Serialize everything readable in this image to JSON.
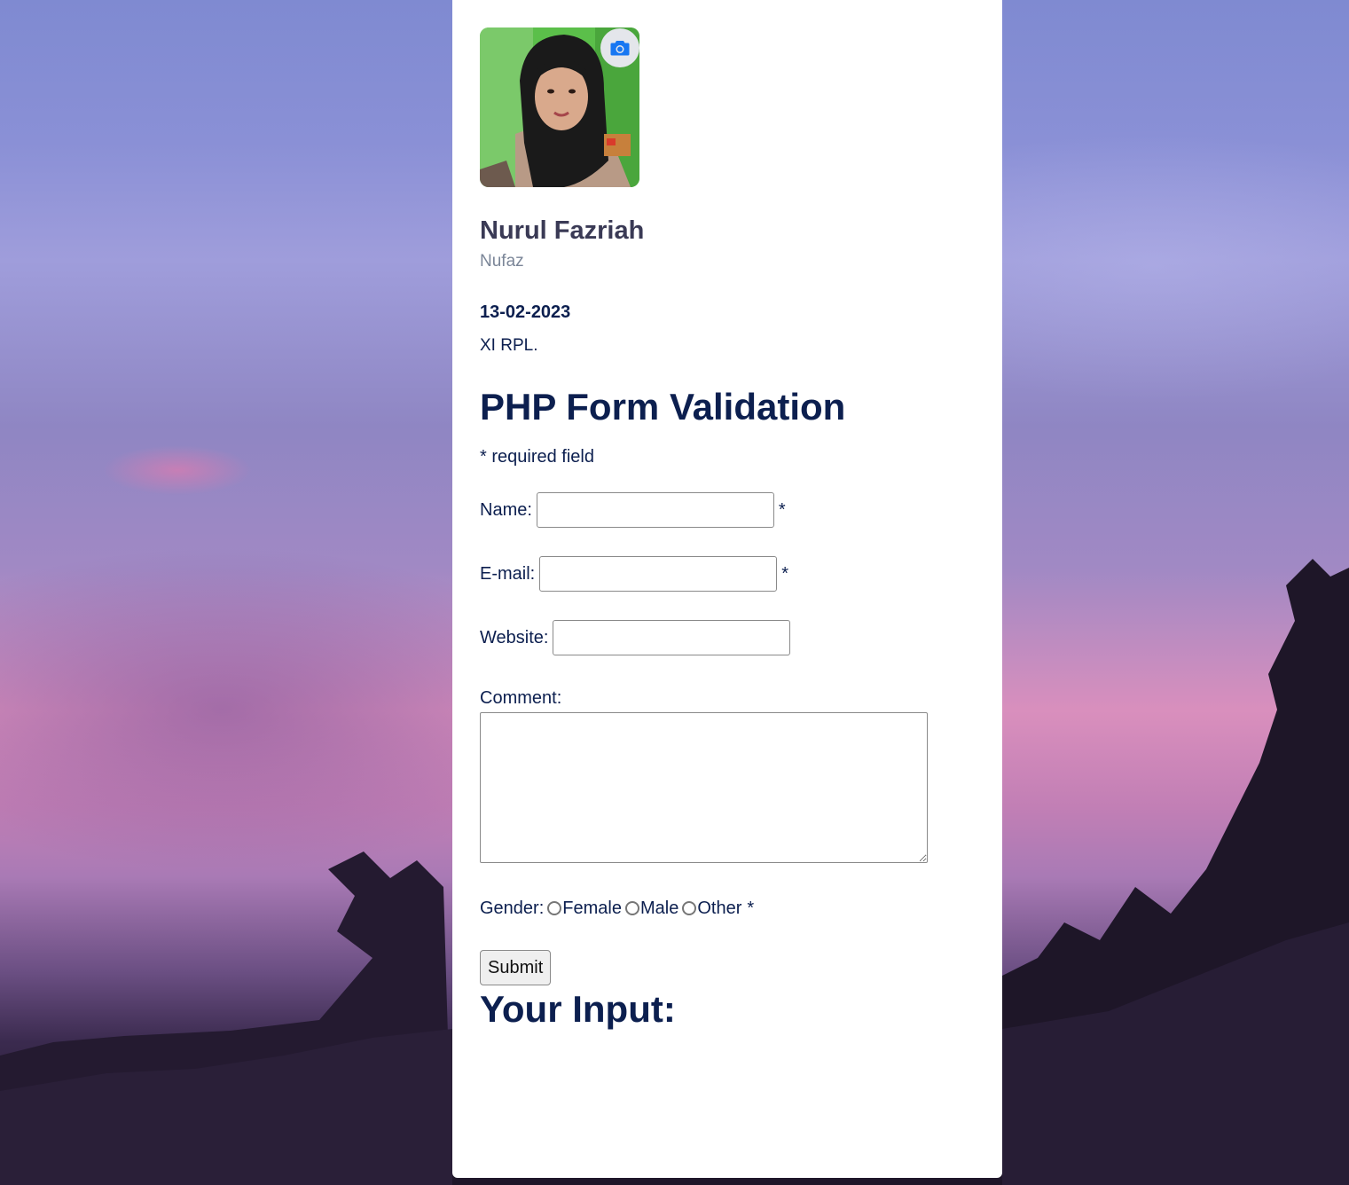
{
  "profile": {
    "name": "Nurul Fazriah",
    "nickname": "Nufaz",
    "date": "13-02-2023",
    "class": "XI RPL."
  },
  "form": {
    "title": "PHP Form Validation",
    "required_note": "* required field",
    "name_label": "Name:",
    "name_value": "",
    "email_label": "E-mail:",
    "email_value": "",
    "website_label": "Website:",
    "website_value": "",
    "comment_label": "Comment:",
    "comment_value": "",
    "required_marker": "*",
    "gender_label": "Gender:",
    "gender_options": [
      "Female",
      "Male",
      "Other"
    ],
    "submit_label": "Submit"
  },
  "output": {
    "title": "Your Input:"
  },
  "colors": {
    "text_primary": "#0c1f4f",
    "name_color": "#3a3a55",
    "muted": "#7b8698",
    "camera_icon": "#1877f2"
  }
}
